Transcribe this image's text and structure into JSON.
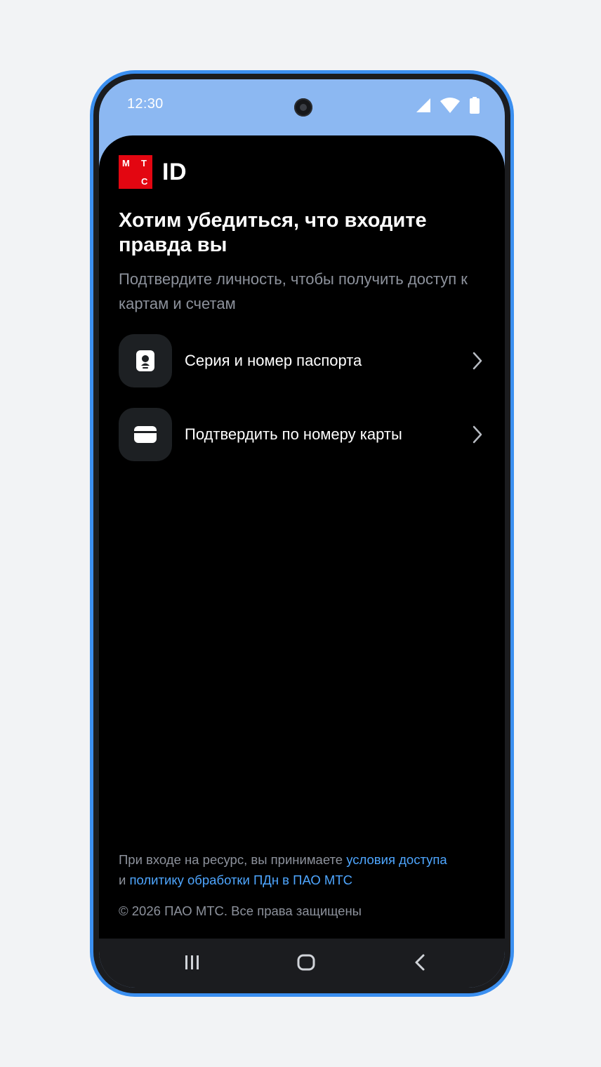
{
  "status_bar": {
    "time": "12:30",
    "icons": [
      "signal-icon",
      "wifi-icon",
      "battery-icon"
    ]
  },
  "logo": {
    "letters": [
      "М",
      "Т",
      "С"
    ],
    "suffix": "ID",
    "brand_color": "#e30611"
  },
  "title": "Хотим убедиться, что входите правда вы",
  "subtitle": "Подтвердите личность, чтобы получить доступ к картам и счетам",
  "options": [
    {
      "label": "Серия и номер паспорта",
      "icon": "passport-icon"
    },
    {
      "label": "Подтвердить по номеру карты",
      "icon": "card-icon"
    }
  ],
  "footer": {
    "legal_prefix": "При входе на ресурс, вы принимаете ",
    "terms_link": "условия доступа",
    "legal_middle": "и ",
    "policy_link": "политику обработки ПДн в ПАО МТС",
    "copyright": "© 2026 ПАО МТС. Все права защищены",
    "link_color": "#4ea6ff"
  },
  "nav_bar": {
    "buttons": [
      "recent-apps-icon",
      "home-icon",
      "back-icon"
    ]
  },
  "colors": {
    "phone_frame": "#3b8ff0",
    "status_bar_bg": "#8cb8f2",
    "screen_bg": "#000000",
    "secondary_text": "#8d929c"
  }
}
